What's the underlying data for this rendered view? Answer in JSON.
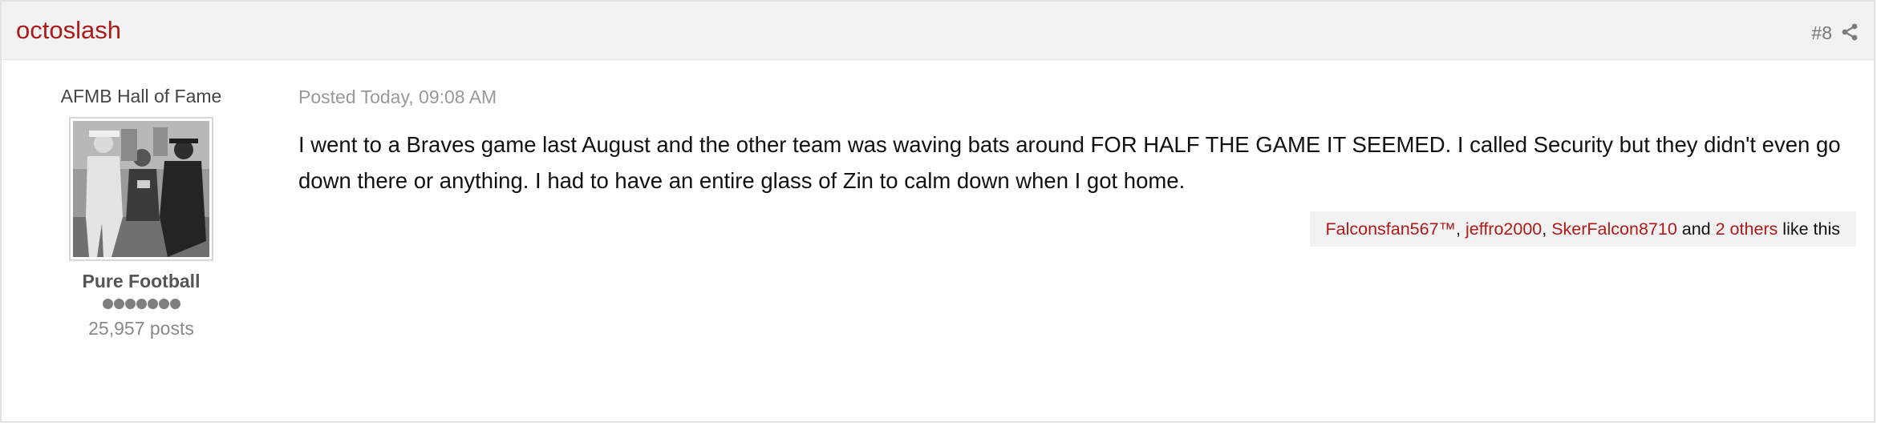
{
  "post": {
    "author_name": "octoslash",
    "post_number": "#8",
    "share_icon": "share-icon",
    "author": {
      "member_title": "AFMB Hall of Fame",
      "group": "Pure Football",
      "pips": 7,
      "post_count": "25,957 posts"
    },
    "meta": "Posted Today, 09:08 AM",
    "body": "I went to a Braves game last August and the other team was waving bats around FOR HALF THE GAME IT SEEMED. I called Security but they didn't even go down there or anything. I had to have an entire glass of Zin to calm down when I got home.",
    "likes": {
      "users": [
        "Falconsfan567™",
        "jeffro2000",
        "SkerFalcon8710"
      ],
      "separator": ", ",
      "and_text": "and",
      "others_link": "2 others",
      "suffix": "like this"
    }
  },
  "colors": {
    "accent": "#ad1a1a",
    "header_bg": "#f2f2f2",
    "muted": "#999999"
  }
}
